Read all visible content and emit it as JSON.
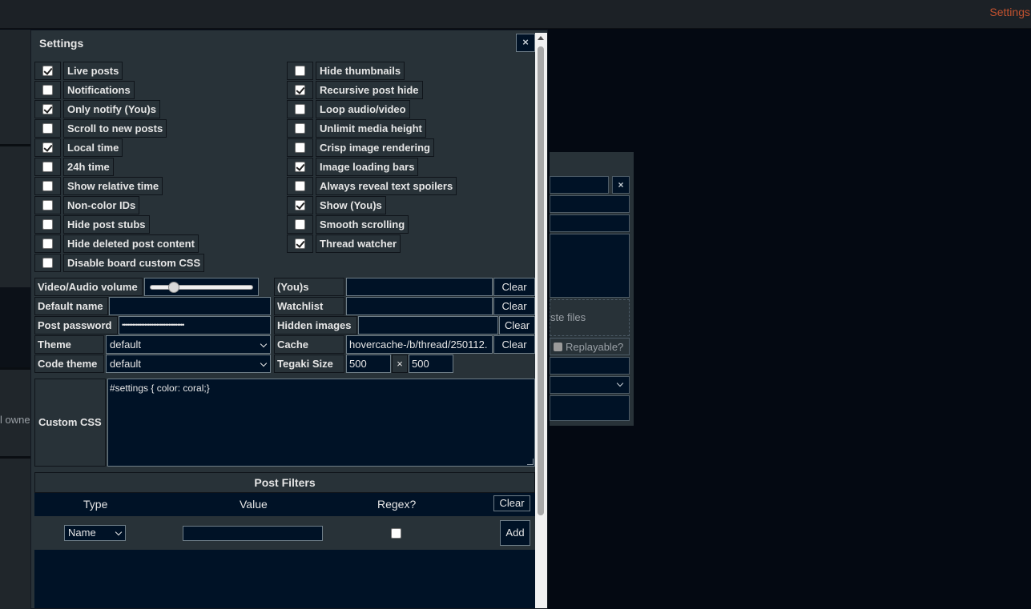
{
  "topbar": {
    "settings_link": "Settings"
  },
  "background": {
    "left_fragment": "l owne",
    "paste_files": "ste files",
    "replayable": "Replayable?",
    "close_x": "×"
  },
  "dialog": {
    "title": "Settings",
    "close": "×",
    "left_options": [
      {
        "label": "Live posts",
        "checked": true
      },
      {
        "label": "Notifications",
        "checked": false
      },
      {
        "label": "Only notify (You)s",
        "checked": true
      },
      {
        "label": "Scroll to new posts",
        "checked": false
      },
      {
        "label": "Local time",
        "checked": true
      },
      {
        "label": "24h time",
        "checked": false
      },
      {
        "label": "Show relative time",
        "checked": false
      },
      {
        "label": "Non-color IDs",
        "checked": false
      },
      {
        "label": "Hide post stubs",
        "checked": false
      },
      {
        "label": "Hide deleted post content",
        "checked": false
      },
      {
        "label": "Disable board custom CSS",
        "checked": false
      }
    ],
    "right_options": [
      {
        "label": "Hide thumbnails",
        "checked": false
      },
      {
        "label": "Recursive post hide",
        "checked": true
      },
      {
        "label": "Loop audio/video",
        "checked": false
      },
      {
        "label": "Unlimit media height",
        "checked": false
      },
      {
        "label": "Crisp image rendering",
        "checked": false
      },
      {
        "label": "Image loading bars",
        "checked": true
      },
      {
        "label": "Always reveal text spoilers",
        "checked": false
      },
      {
        "label": "Show (You)s",
        "checked": true
      },
      {
        "label": "Smooth scrolling",
        "checked": false
      },
      {
        "label": "Thread watcher",
        "checked": true
      }
    ],
    "fields": {
      "volume_label": "Video/Audio volume",
      "volume_level": 0.2,
      "default_name_label": "Default name",
      "default_name_value": "",
      "post_password_label": "Post password",
      "post_password_value": "••••••••••••••••••••••••••••••••••••",
      "theme_label": "Theme",
      "theme_value": "default",
      "code_theme_label": "Code theme",
      "code_theme_value": "default",
      "yous_label": "(You)s",
      "watchlist_label": "Watchlist",
      "hidden_images_label": "Hidden images",
      "cache_label": "Cache",
      "cache_value": "hovercache-/b/thread/250112.",
      "tegaki_label": "Tegaki Size",
      "tegaki_w": "500",
      "tegaki_times": "×",
      "tegaki_h": "500",
      "clear": "Clear"
    },
    "custom_css_label": "Custom CSS",
    "custom_css_value": "#settings { color: coral;}",
    "post_filters": {
      "title": "Post Filters",
      "col_type": "Type",
      "col_value": "Value",
      "col_regex": "Regex?",
      "clear": "Clear",
      "type_value": "Name",
      "add": "Add"
    }
  }
}
